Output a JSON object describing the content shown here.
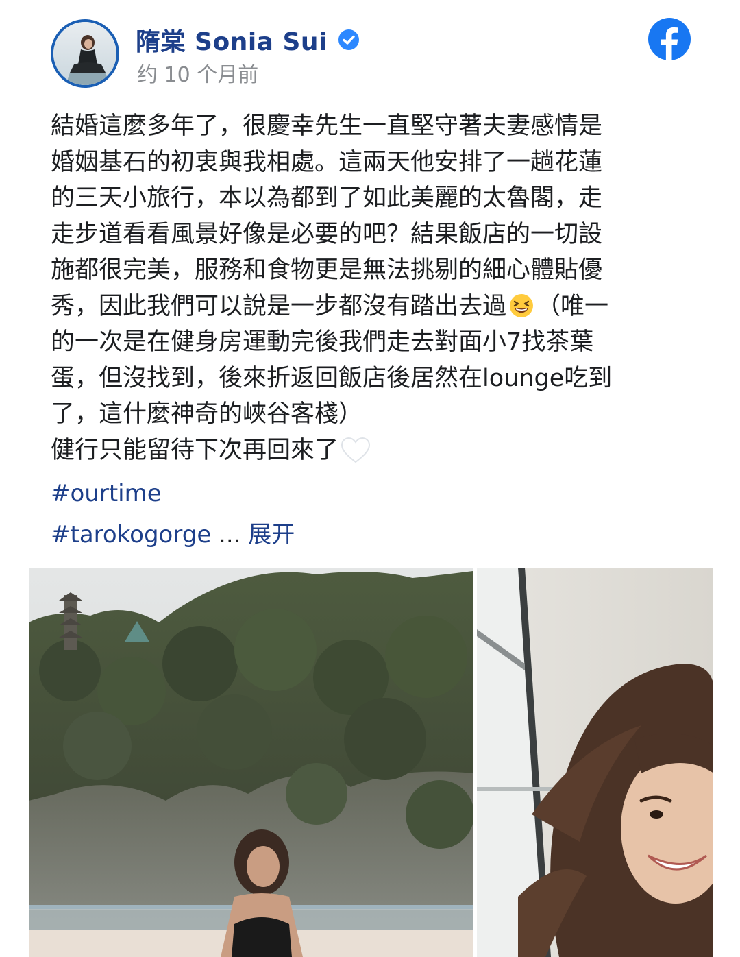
{
  "post": {
    "author": "隋棠 Sonia Sui",
    "timestamp": "约 10 个月前",
    "body_lines": [
      "結婚這麼多年了，很慶幸先生一直堅守著夫妻感情是",
      "婚姻基石的初衷與我相處。這兩天他安排了一趟花蓮",
      "的三天小旅行，本以為都到了如此美麗的太魯閣，走",
      "走步道看看風景好像是必要的吧？結果飯店的一切設",
      "施都很完美，服務和食物更是無法挑剔的細心體貼優",
      "秀，因此我們可以說是一步都沒有踏出去過",
      "（唯一",
      "的一次是在健身房運動完後我們走去對面小7找茶葉",
      "蛋，但沒找到，後來折返回飯店後居然在lounge吃到",
      "了，這什麼神奇的峽谷客棧）",
      "健行只能留待下次再回來了"
    ],
    "hashtags": [
      "#ourtime",
      "#tarokogorge"
    ],
    "ellipsis": "...",
    "expand_label": "展开"
  },
  "icons": {
    "verified": "verified-badge-icon",
    "facebook": "facebook-logo-icon",
    "laughing_emoji": "laughing-emoji-icon",
    "white_heart": "white-heart-icon"
  },
  "colors": {
    "author_name": "#1d3f8a",
    "verified_badge": "#2d88ff",
    "facebook_blue": "#1877f2",
    "hashtag": "#1d3f8a",
    "body_text": "#1c1e21",
    "timestamp": "#8a8d91"
  }
}
